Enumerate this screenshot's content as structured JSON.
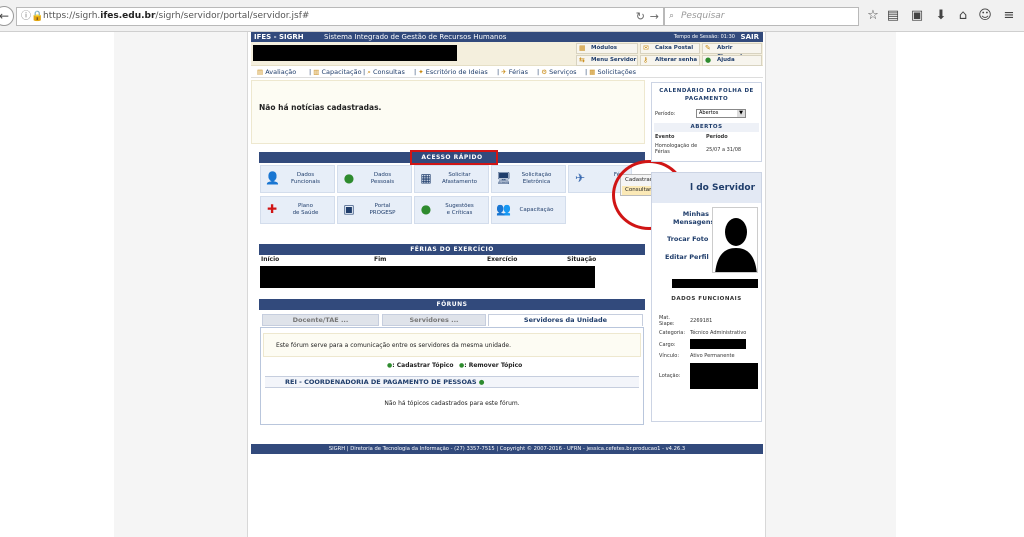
{
  "browser": {
    "url_prefix": "https://sigrh.",
    "url_domain": "ifes.edu.br",
    "url_path": "/sigrh/servidor/portal/servidor.jsf#",
    "search_placeholder": "Pesquisar"
  },
  "header": {
    "system_name": "IFES - SIGRH",
    "system_subtitle": "Sistema Integrado de Gestão de Recursos Humanos",
    "session_label": "Tempo de Sessão: 01:30",
    "logout_label": "SAIR"
  },
  "user_buttons": {
    "modulos": "Módulos",
    "caixa_postal": "Caixa Postal",
    "abrir_chamado": "Abrir Chamado",
    "menu_servidor": "Menu Servidor",
    "alterar_senha": "Alterar senha",
    "ajuda": "Ajuda"
  },
  "menu": {
    "items": [
      "Avaliação",
      "Capacitação",
      "Consultas",
      "Escritório de Ideias",
      "Férias",
      "Serviços",
      "Solicitações"
    ]
  },
  "news": {
    "empty_message": "Não há notícias cadastradas."
  },
  "quick_access": {
    "title": "Acesso Rápido",
    "tiles": [
      {
        "l1": "Dados",
        "l2": "Funcionais"
      },
      {
        "l1": "Dados",
        "l2": "Pessoais"
      },
      {
        "l1": "Solicitar",
        "l2": "Afastamento"
      },
      {
        "l1": "Solicitação",
        "l2": "Eletrônica"
      },
      {
        "l1": "Fé",
        "l2": ""
      },
      {
        "l1": "Plano",
        "l2": "de Saúde"
      },
      {
        "l1": "Portal",
        "l2": "PROGESP"
      },
      {
        "l1": "Sugestões",
        "l2": "e Críticas"
      },
      {
        "l1": "Capacitação",
        "l2": ""
      }
    ],
    "popup": [
      "Cadastrar",
      "Consultar/Alterar"
    ]
  },
  "ferias": {
    "title": "Férias do Exercício",
    "columns": [
      "Início",
      "Fim",
      "Exercício",
      "Situação"
    ]
  },
  "forums": {
    "title": "Fóruns",
    "tabs": [
      "Docente/TAE ...",
      "Servidores ...",
      "Servidores da Unidade"
    ],
    "description": "Este fórum serve para a comunicação entre os servidores da mesma unidade.",
    "cadastrar_topico": ": Cadastrar Tópico",
    "remover_topico": ": Remover Tópico",
    "group_title": "REI - COORDENADORIA DE PAGAMENTO DE PESSOAS",
    "empty_message": "Não há tópicos cadastrados para este fórum."
  },
  "calendar": {
    "title": "Calendário da Folha de Pagamento",
    "period_label": "Período:",
    "period_value": "Abertos",
    "open_title": "Abertos",
    "col_event": "Evento",
    "col_period": "Período",
    "event_name": "Homologação de Férias",
    "event_period": "25/07 a 31/08"
  },
  "profile": {
    "title": "l do Servidor",
    "links": [
      "Minhas Mensagens",
      "Trocar Foto",
      "Editar Perfil"
    ],
    "section_title": "Dados Funcionais",
    "fields": [
      {
        "label": "Mat. Siape:",
        "value": "2269181"
      },
      {
        "label": "Categoria:",
        "value": "Técnico Administrativo"
      },
      {
        "label": "Cargo:",
        "value": ""
      },
      {
        "label": "Vínculo:",
        "value": "Ativo Permanente"
      },
      {
        "label": "Lotação:",
        "value": ""
      }
    ]
  },
  "footer": {
    "text": "SIGRH | Diretoria de Tecnologia da Informação - (27) 3357-7515 | Copyright © 2007-2016 - UFRN - jessica.cefetes.br.producao1 - v4.26.3"
  },
  "colors": {
    "header_blue": "#324a7c",
    "highlight_red": "#d01515",
    "tile_bg": "#e7eef8"
  }
}
